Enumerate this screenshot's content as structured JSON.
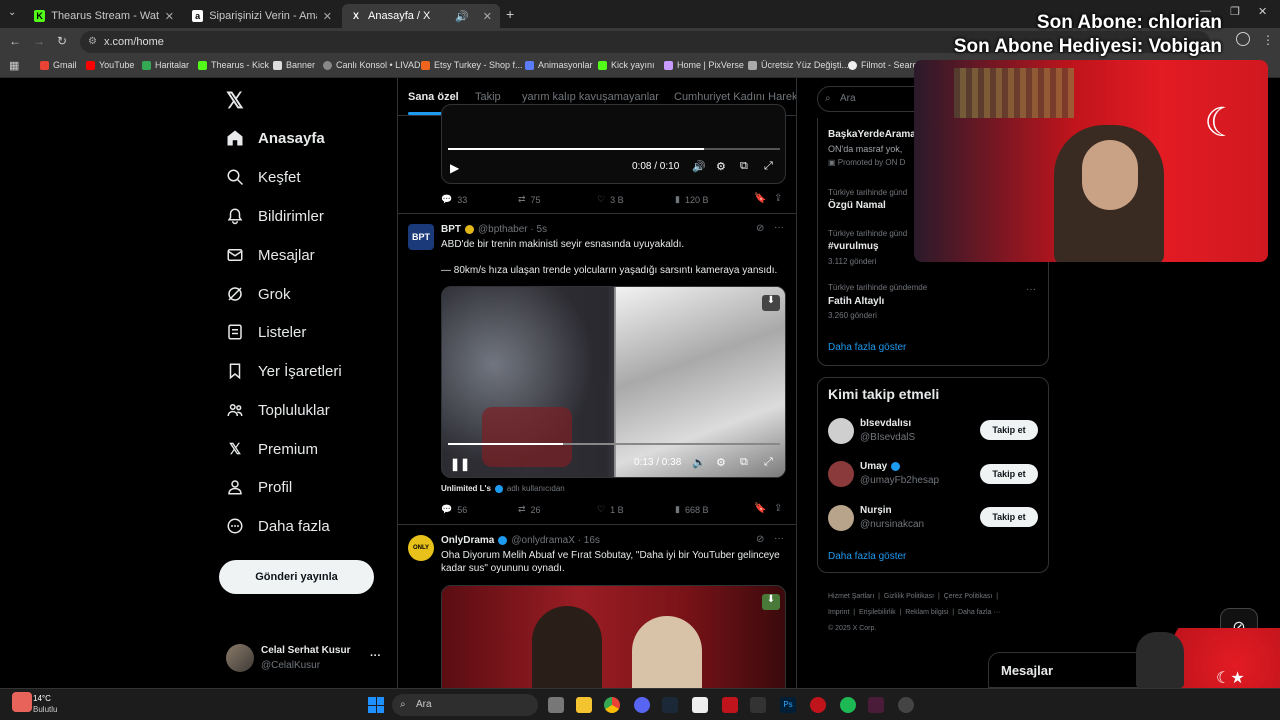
{
  "browser": {
    "tabs": [
      {
        "title": "Thearus Stream - Watch Live o",
        "fav": "K"
      },
      {
        "title": "Siparişinizi Verin - Amazon Öde",
        "fav": "a"
      },
      {
        "title": "Anasayfa / X",
        "fav": "X"
      }
    ],
    "url": "x.com/home",
    "bookmarks": [
      "Gmail",
      "YouTube",
      "Haritalar",
      "Thearus - Kick",
      "Banner",
      "Canlı Konsol • LIVAD",
      "Etsy Turkey - Shop f...",
      "Animasyonlar",
      "Kick yayını",
      "Home | PixVerse",
      "Ücretsiz Yüz Değişti...",
      "Filmot - Search in Y..."
    ]
  },
  "overlay": {
    "line1": "Son Abone: chlorian",
    "line2": "Son Abone Hediyesi: Vobigan"
  },
  "nav": {
    "items": [
      "Anasayfa",
      "Keşfet",
      "Bildirimler",
      "Mesajlar",
      "Grok",
      "Listeler",
      "Yer İşaretleri",
      "Topluluklar",
      "Premium",
      "Profil",
      "Daha fazla"
    ],
    "post_label": "Gönderi yayınla",
    "account_name": "Celal Serhat Kusur",
    "account_handle": "@CelalKusur"
  },
  "feed": {
    "tabs": [
      "Sana özel",
      "Takip",
      "yarım kalıp kavuşamayanlar",
      "Cumhuriyet Kadını Hareke"
    ],
    "t1": {
      "time": "0:08 / 0:10",
      "replies": "33",
      "reposts": "75",
      "likes": "3 B",
      "views": "120 B"
    },
    "t2": {
      "name": "BPT",
      "handle": "@bpthaber · 5s",
      "text1": "ABD'de bir trenin makinisti seyir esnasında uyuyakaldı.",
      "text2": "— 80km/s hıza ulaşan trende yolcuların yaşadığı sarsıntı kameraya yansıdı.",
      "time": "0:13 / 0:38",
      "credit": "Unlimited L's",
      "credit_suffix": "adlı kullanıcıdan",
      "replies": "56",
      "reposts": "26",
      "likes": "1 B",
      "views": "668 B"
    },
    "t3": {
      "name": "OnlyDrama",
      "handle": "@onlydramaX · 16s",
      "text": "Oha Diyorum Melih Abuaf ve Fırat Sobutay, \"Daha iyi bir YouTuber gelinceye kadar sus\" oyununu oynadı."
    }
  },
  "right": {
    "search_placeholder": "Ara",
    "trends": {
      "promo_title": "BaşkaYerdeArama",
      "promo_desc": "ON'da masraf yok,",
      "promo_by": "Promoted by ON D",
      "items": [
        {
          "ctx": "Türkiye tarihinde günd",
          "name": "Özgü Namal",
          "count": ""
        },
        {
          "ctx": "Türkiye tarihinde günd",
          "name": "#vurulmuş",
          "count": "3.112 gönderi"
        },
        {
          "ctx": "Türkiye tarihinde gündemde",
          "name": "Fatih Altaylı",
          "count": "3.260 gönderi"
        }
      ],
      "more": "Daha fazla göster"
    },
    "who": {
      "title": "Kimi takip etmeli",
      "people": [
        {
          "name": "bIsevdalısı",
          "handle": "@BIsevdalS"
        },
        {
          "name": "Umay",
          "handle": "@umayFb2hesap"
        },
        {
          "name": "Nurşin",
          "handle": "@nursinakcan"
        }
      ],
      "follow": "Takip et",
      "more": "Daha fazla göster"
    },
    "footer": [
      "Hizmet Şartları",
      "Gizlilik Politikası",
      "Çerez Politikası",
      "Imprint",
      "Erişilebilirlik",
      "Reklam bilgisi",
      "Daha fazla ···",
      "© 2025 X Corp."
    ],
    "messages": "Mesajlar"
  },
  "taskbar": {
    "weather_temp": "14°C",
    "weather_desc": "Bulutlu",
    "search": "Ara"
  }
}
